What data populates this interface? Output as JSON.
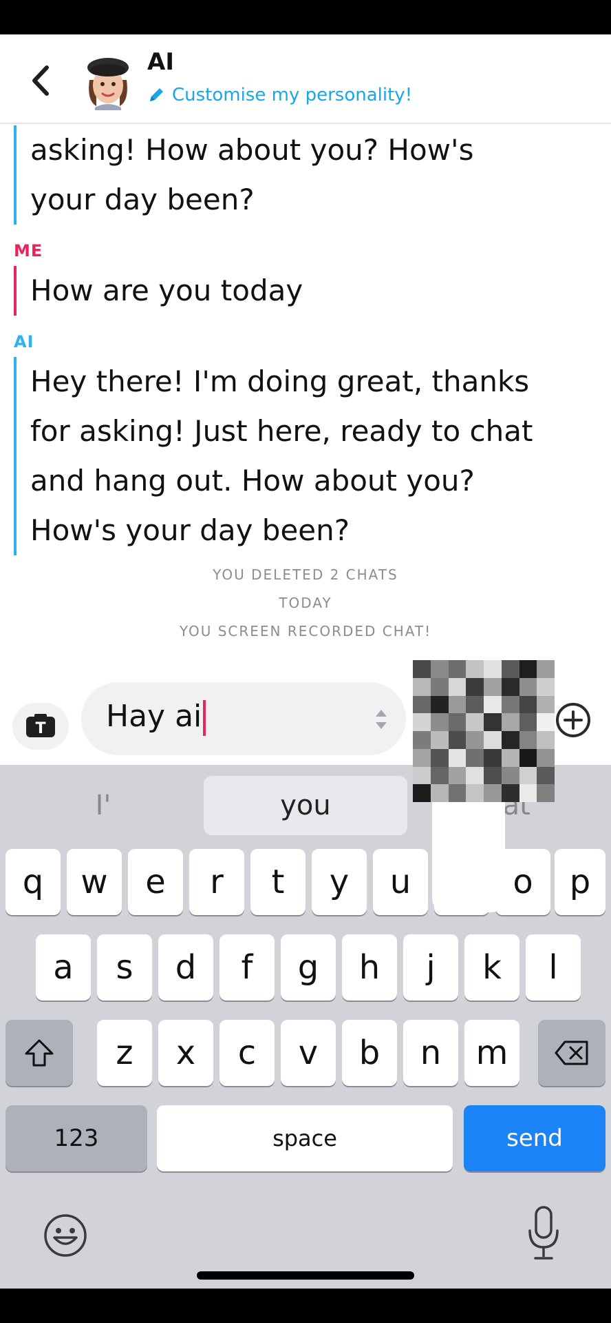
{
  "header": {
    "title": "AI",
    "subtitle": "Customise my personality!"
  },
  "messages": {
    "partial_ai_lines": [
      "asking! How about you? How's",
      "your day been?"
    ],
    "me_sender": "ME",
    "me_text": "How are you today",
    "ai_sender": "AI",
    "ai_lines": [
      "Hey there! I'm doing great, thanks",
      "for asking! Just here, ready to chat",
      "and hang out. How about you?",
      "How's your day been?"
    ]
  },
  "system": {
    "deleted": "YOU DELETED 2 CHATS",
    "today": "TODAY",
    "recorded": "YOU SCREEN RECORDED CHAT!"
  },
  "composer": {
    "input_value": "Hay ai"
  },
  "keyboard": {
    "suggestions": [
      "I'",
      "you",
      "hat"
    ],
    "row1": [
      "q",
      "w",
      "e",
      "r",
      "t",
      "y",
      "u",
      "",
      "o",
      "p"
    ],
    "row2": [
      "a",
      "s",
      "d",
      "f",
      "g",
      "h",
      "j",
      "k",
      "l"
    ],
    "row3": [
      "z",
      "x",
      "c",
      "v",
      "b",
      "n",
      "m"
    ],
    "numbers_label": "123",
    "space_label": "space",
    "send_label": "send"
  },
  "colors": {
    "ai_accent": "#2eb2f0",
    "me_accent": "#e8255b",
    "send_blue": "#1a84f7",
    "link_blue": "#1aa6e6"
  }
}
